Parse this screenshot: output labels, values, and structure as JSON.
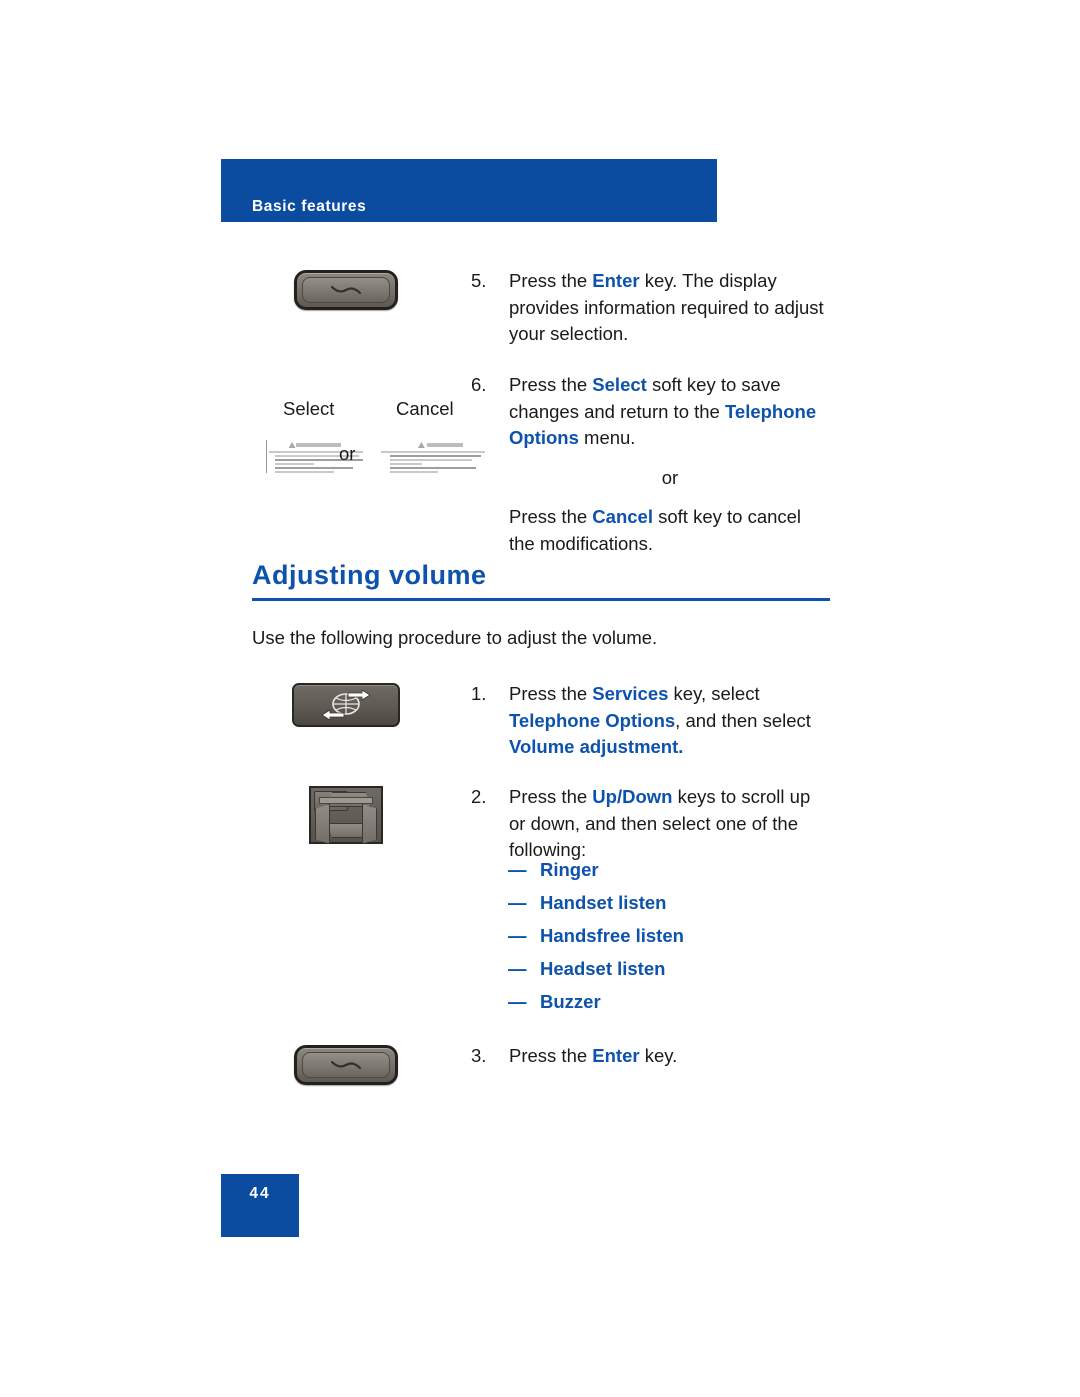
{
  "header": {
    "title": "Basic features"
  },
  "steps_top": [
    {
      "number": "5.",
      "art": "enter-key",
      "segments": [
        {
          "t": "Press the ",
          "b": false
        },
        {
          "t": "Enter",
          "b": true
        },
        {
          "t": " key. The display provides information required to adjust your selection.",
          "b": false
        }
      ]
    },
    {
      "number": "6.",
      "art": "softkeys",
      "segments": [
        {
          "t": "Press the ",
          "b": false
        },
        {
          "t": "Select",
          "b": true
        },
        {
          "t": " soft key to save changes and return to the ",
          "b": false
        },
        {
          "t": "Telephone Options",
          "b": true
        },
        {
          "t": " menu.",
          "b": false
        }
      ],
      "or_label": "or",
      "segments2": [
        {
          "t": "Press the ",
          "b": false
        },
        {
          "t": "Cancel",
          "b": true
        },
        {
          "t": " soft key to cancel the modifications.",
          "b": false
        }
      ]
    }
  ],
  "softkeys": {
    "select_label": "Select",
    "cancel_label": "Cancel",
    "or_label": "or"
  },
  "section": {
    "heading": "Adjusting volume",
    "intro": "Use the following procedure to adjust the volume."
  },
  "steps_volume": [
    {
      "number": "1.",
      "art": "services-key",
      "segments": [
        {
          "t": "Press the ",
          "b": false
        },
        {
          "t": "Services",
          "b": true
        },
        {
          "t": " key, select ",
          "b": false
        },
        {
          "t": "Telephone Options",
          "b": true
        },
        {
          "t": ", and then select ",
          "b": false
        },
        {
          "t": "Volume adjustment.",
          "b": true
        }
      ]
    },
    {
      "number": "2.",
      "art": "nav-key",
      "segments": [
        {
          "t": "Press the ",
          "b": false
        },
        {
          "t": "Up/Down",
          "b": true
        },
        {
          "t": " keys to scroll up or down, and then select one of the following:",
          "b": false
        }
      ]
    },
    {
      "number": "3.",
      "art": "enter-key",
      "segments": [
        {
          "t": "Press the ",
          "b": false
        },
        {
          "t": "Enter",
          "b": true
        },
        {
          "t": " key.",
          "b": false
        }
      ]
    }
  ],
  "bullets": {
    "dash": "—",
    "items": [
      "Ringer",
      "Handset listen",
      "Handsfree listen",
      "Headset listen",
      "Buzzer"
    ]
  },
  "footer": {
    "page_number": "44"
  },
  "colors": {
    "brand_blue": "#0b4ca0",
    "accent_blue": "#0d52ad",
    "text": "#1a1a1a"
  }
}
